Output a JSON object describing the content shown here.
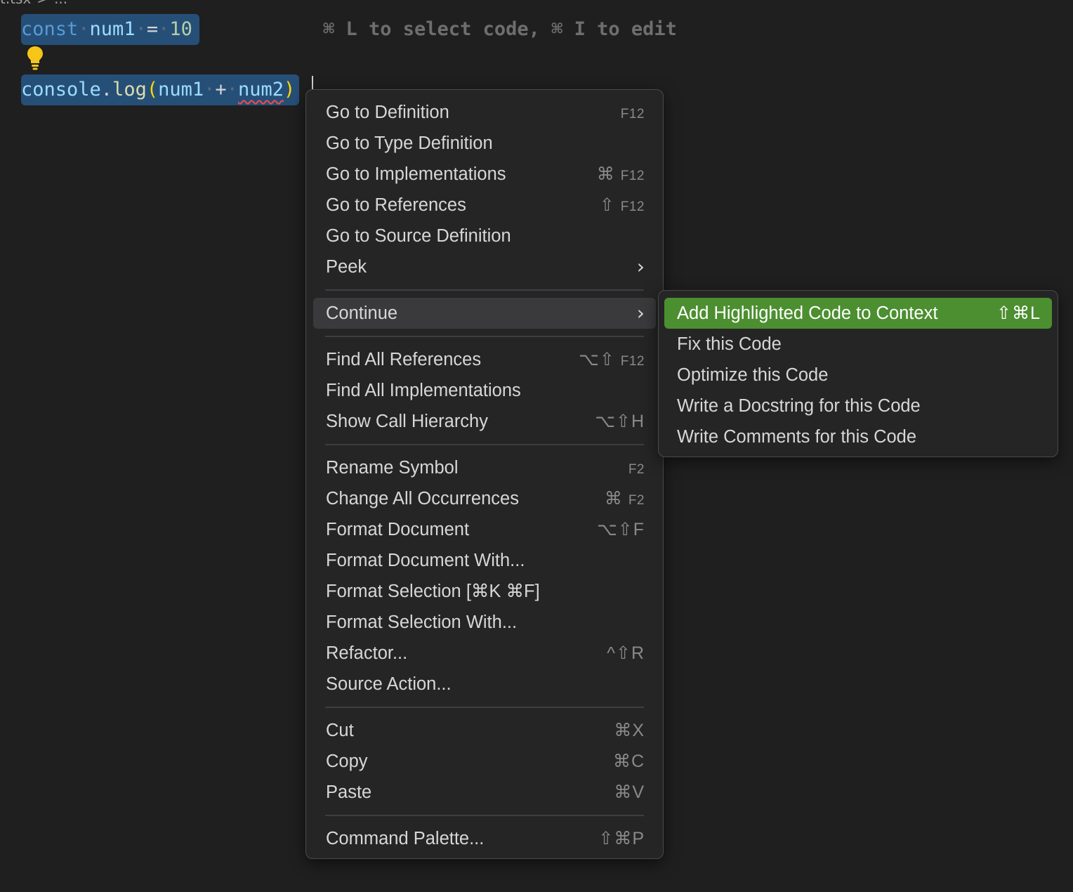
{
  "breadcrumb": {
    "file": "t.tsx",
    "sep": ">",
    "rest": "..."
  },
  "editor": {
    "line1": {
      "kw": "const",
      "var": "num1",
      "op": "=",
      "num": "10"
    },
    "line3": {
      "obj": "console",
      "dot": ".",
      "fn": "log",
      "lparen": "(",
      "a": "num1",
      "plus": "+",
      "b": "num2",
      "rparen": ")"
    },
    "ws_dot": "·",
    "hint": "⌘ L to select code, ⌘ I to edit"
  },
  "menu": {
    "group1": [
      {
        "label": "Go to Definition",
        "kb": "F12"
      },
      {
        "label": "Go to Type Definition",
        "kb": ""
      },
      {
        "label": "Go to Implementations",
        "kb_sym": "⌘",
        "kb": "F12"
      },
      {
        "label": "Go to References",
        "kb_sym": "⇧",
        "kb": "F12"
      },
      {
        "label": "Go to Source Definition",
        "kb": ""
      },
      {
        "label": "Peek",
        "kb": ""
      }
    ],
    "continue": {
      "label": "Continue"
    },
    "group3": [
      {
        "label": "Find All References",
        "kb_sym": "⌥⇧",
        "kb": "F12"
      },
      {
        "label": "Find All Implementations",
        "kb": ""
      },
      {
        "label": "Show Call Hierarchy",
        "kb": "⌥⇧H"
      }
    ],
    "group4": [
      {
        "label": "Rename Symbol",
        "kb": "F2"
      },
      {
        "label": "Change All Occurrences",
        "kb_sym": "⌘",
        "kb": "F2"
      },
      {
        "label": "Format Document",
        "kb": "⌥⇧F"
      },
      {
        "label": "Format Document With...",
        "kb": ""
      },
      {
        "label": "Format Selection [⌘K ⌘F]",
        "kb": ""
      },
      {
        "label": "Format Selection With...",
        "kb": ""
      },
      {
        "label": "Refactor...",
        "kb": "^⇧R"
      },
      {
        "label": "Source Action...",
        "kb": ""
      }
    ],
    "group5": [
      {
        "label": "Cut",
        "kb": "⌘X"
      },
      {
        "label": "Copy",
        "kb": "⌘C"
      },
      {
        "label": "Paste",
        "kb": "⌘V"
      }
    ],
    "group6": [
      {
        "label": "Command Palette...",
        "kb": "⇧⌘P"
      }
    ]
  },
  "submenu": [
    {
      "label": "Add Highlighted Code to Context",
      "kb": "⇧⌘L"
    },
    {
      "label": "Fix this Code",
      "kb": ""
    },
    {
      "label": "Optimize this Code",
      "kb": ""
    },
    {
      "label": "Write a Docstring for this Code",
      "kb": ""
    },
    {
      "label": "Write Comments for this Code",
      "kb": ""
    }
  ],
  "colors": {
    "highlight": "#4c8f31",
    "selection": "#264f78",
    "bulb": "#f5c518"
  }
}
